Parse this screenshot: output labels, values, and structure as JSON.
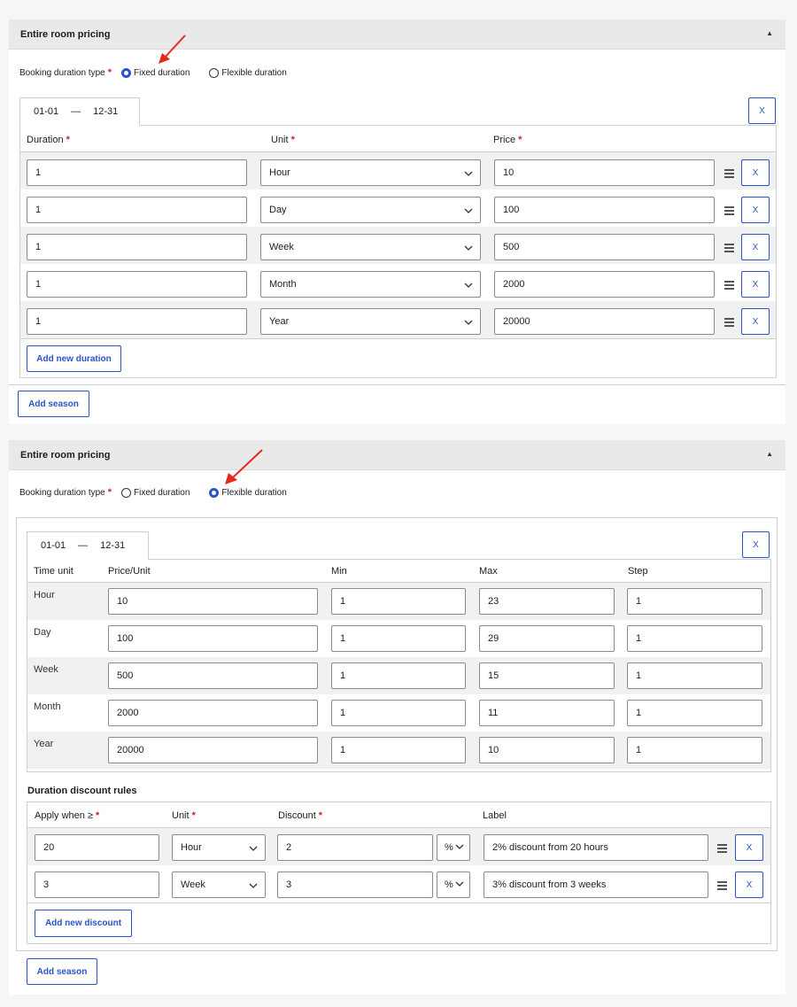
{
  "panel1": {
    "title": "Entire room pricing",
    "booking_label": "Booking duration type",
    "required_mark": "*",
    "radio_fixed": "Fixed duration",
    "radio_flexible": "Flexible duration",
    "selected": "fixed",
    "season": {
      "start": "01-01",
      "dash": "—",
      "end": "12-31",
      "remove": "X"
    },
    "columns": {
      "duration": "Duration",
      "unit": "Unit",
      "price": "Price"
    },
    "rows": [
      {
        "duration": "1",
        "unit": "Hour",
        "price": "10"
      },
      {
        "duration": "1",
        "unit": "Day",
        "price": "100"
      },
      {
        "duration": "1",
        "unit": "Week",
        "price": "500"
      },
      {
        "duration": "1",
        "unit": "Month",
        "price": "2000"
      },
      {
        "duration": "1",
        "unit": "Year",
        "price": "20000"
      }
    ],
    "row_remove": "X",
    "add_duration": "Add new duration",
    "add_season": "Add season"
  },
  "panel2": {
    "title": "Entire room pricing",
    "booking_label": "Booking duration type",
    "required_mark": "*",
    "radio_fixed": "Fixed duration",
    "radio_flexible": "Flexible duration",
    "selected": "flexible",
    "season": {
      "start": "01-01",
      "dash": "—",
      "end": "12-31",
      "remove": "X"
    },
    "columns": {
      "time_unit": "Time unit",
      "price_unit": "Price/Unit",
      "min": "Min",
      "max": "Max",
      "step": "Step"
    },
    "rows": [
      {
        "unit": "Hour",
        "price": "10",
        "min": "1",
        "max": "23",
        "step": "1"
      },
      {
        "unit": "Day",
        "price": "100",
        "min": "1",
        "max": "29",
        "step": "1"
      },
      {
        "unit": "Week",
        "price": "500",
        "min": "1",
        "max": "15",
        "step": "1"
      },
      {
        "unit": "Month",
        "price": "2000",
        "min": "1",
        "max": "11",
        "step": "1"
      },
      {
        "unit": "Year",
        "price": "20000",
        "min": "1",
        "max": "10",
        "step": "1"
      }
    ],
    "discount_title": "Duration discount rules",
    "discount_columns": {
      "apply": "Apply when ≥",
      "unit": "Unit",
      "discount": "Discount",
      "label": "Label"
    },
    "discounts": [
      {
        "apply": "20",
        "unit": "Hour",
        "discount": "2",
        "type": "%",
        "label": "2% discount from 20 hours"
      },
      {
        "apply": "3",
        "unit": "Week",
        "discount": "3",
        "type": "%",
        "label": "3% discount from 3 weeks"
      }
    ],
    "row_remove": "X",
    "add_discount": "Add new discount",
    "add_season": "Add season"
  },
  "colors": {
    "accent": "#2a54c9",
    "required": "#d32020",
    "annotation_arrow": "#e8261c"
  },
  "icons": [
    "collapse-up-icon",
    "chevron-down-icon",
    "drag-handle-icon",
    "annotation-arrow-icon"
  ]
}
